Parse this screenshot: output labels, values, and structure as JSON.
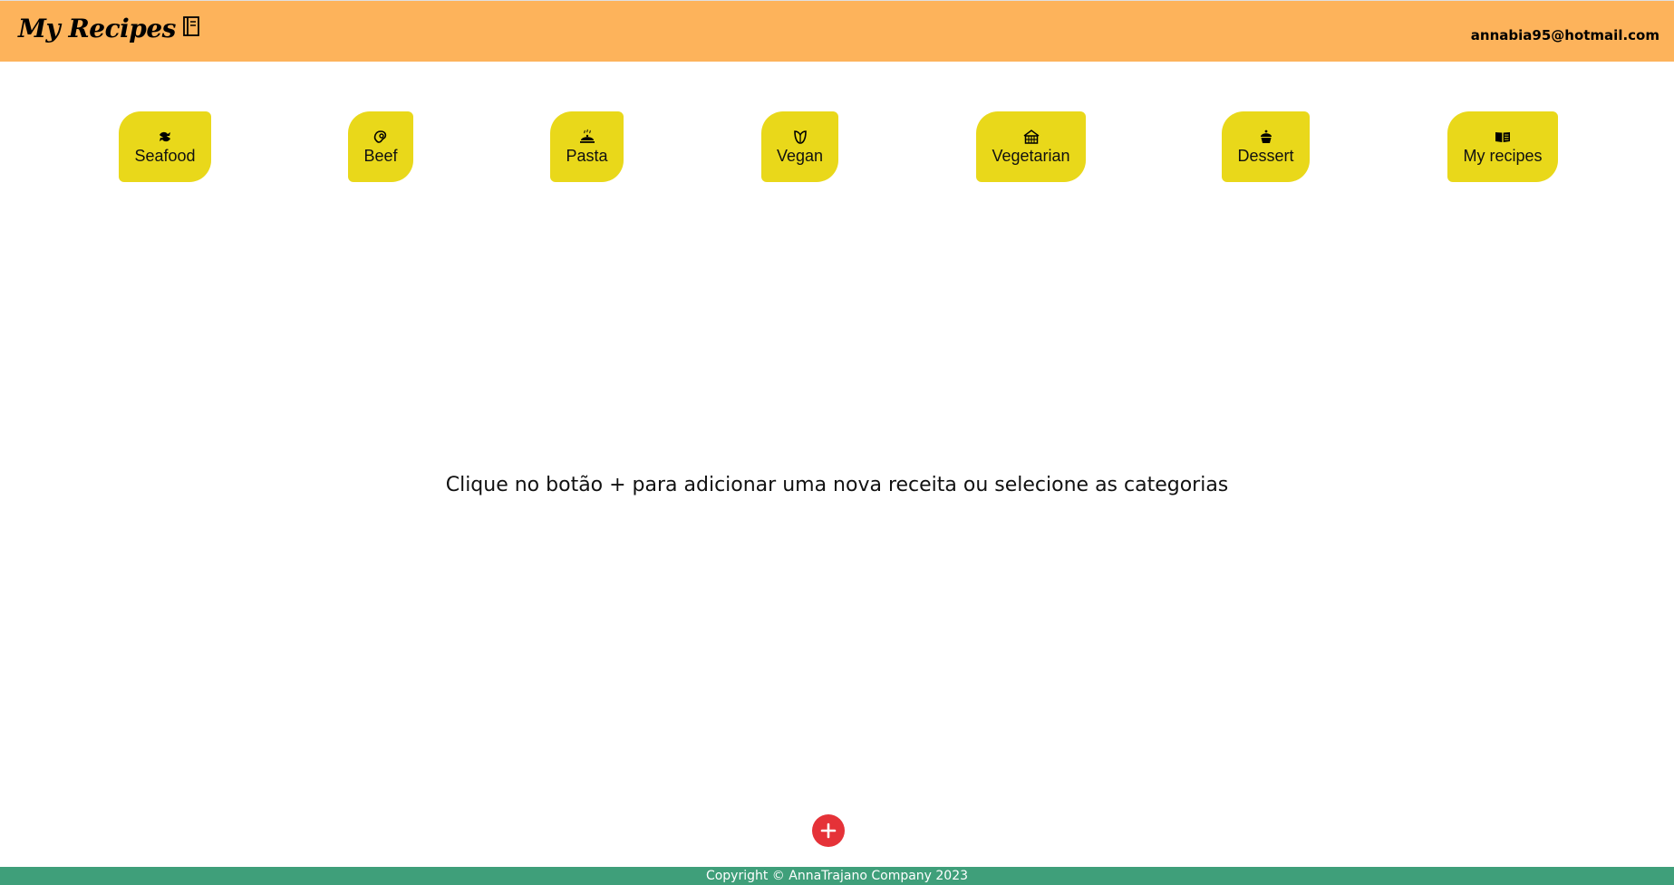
{
  "header": {
    "title": "My Recipes",
    "title_icon": "notebook-icon",
    "user_email": "annabia95@hotmail.com",
    "background_color": "#fdb35b"
  },
  "categories": [
    {
      "label": "Seafood",
      "icon": "fish-icon"
    },
    {
      "label": "Beef",
      "icon": "steak-icon"
    },
    {
      "label": "Pasta",
      "icon": "cloche-icon"
    },
    {
      "label": "Vegan",
      "icon": "leaf-icon"
    },
    {
      "label": "Vegetarian",
      "icon": "salad-basket-icon"
    },
    {
      "label": "Dessert",
      "icon": "cupcake-icon"
    },
    {
      "label": "My recipes",
      "icon": "open-book-icon"
    }
  ],
  "category_color": "#e9d81a",
  "main": {
    "message": "Clique no botão + para adicionar uma nova receita ou selecione as categorias"
  },
  "add_button": {
    "icon": "plus-icon",
    "color": "#e53238"
  },
  "footer": {
    "text": "Copyright © AnnaTrajano Company 2023",
    "background_color": "#3f9f7a"
  }
}
